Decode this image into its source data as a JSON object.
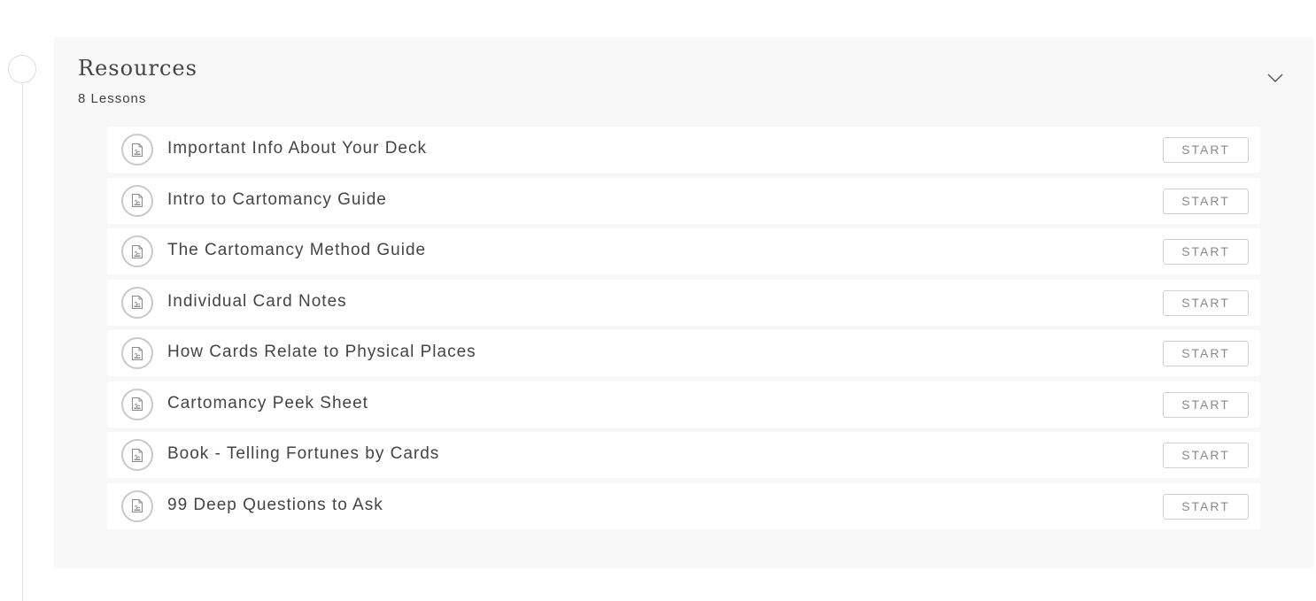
{
  "section": {
    "title": "Resources",
    "lesson_count": "8 Lessons",
    "toggle_icon": "chevron-down-icon"
  },
  "lessons": [
    {
      "title": "Important Info About Your Deck",
      "icon": "pdf-file-icon",
      "action": "START"
    },
    {
      "title": "Intro to Cartomancy Guide",
      "icon": "pdf-file-icon",
      "action": "START"
    },
    {
      "title": "The Cartomancy Method Guide",
      "icon": "pdf-file-icon",
      "action": "START"
    },
    {
      "title": "Individual Card Notes",
      "icon": "pdf-file-icon",
      "action": "START"
    },
    {
      "title": "How Cards Relate to Physical Places",
      "icon": "pdf-file-icon",
      "action": "START"
    },
    {
      "title": "Cartomancy Peek Sheet",
      "icon": "pdf-file-icon",
      "action": "START"
    },
    {
      "title": "Book - Telling Fortunes by Cards",
      "icon": "pdf-file-icon",
      "action": "START"
    },
    {
      "title": "99 Deep Questions to Ask",
      "icon": "pdf-file-icon",
      "action": "START"
    }
  ],
  "colors": {
    "panel_background": "#f8f8f8",
    "row_background": "#ffffff",
    "text": "#444444",
    "button_text": "#8a8a8a",
    "border": "#cfcfcf"
  }
}
